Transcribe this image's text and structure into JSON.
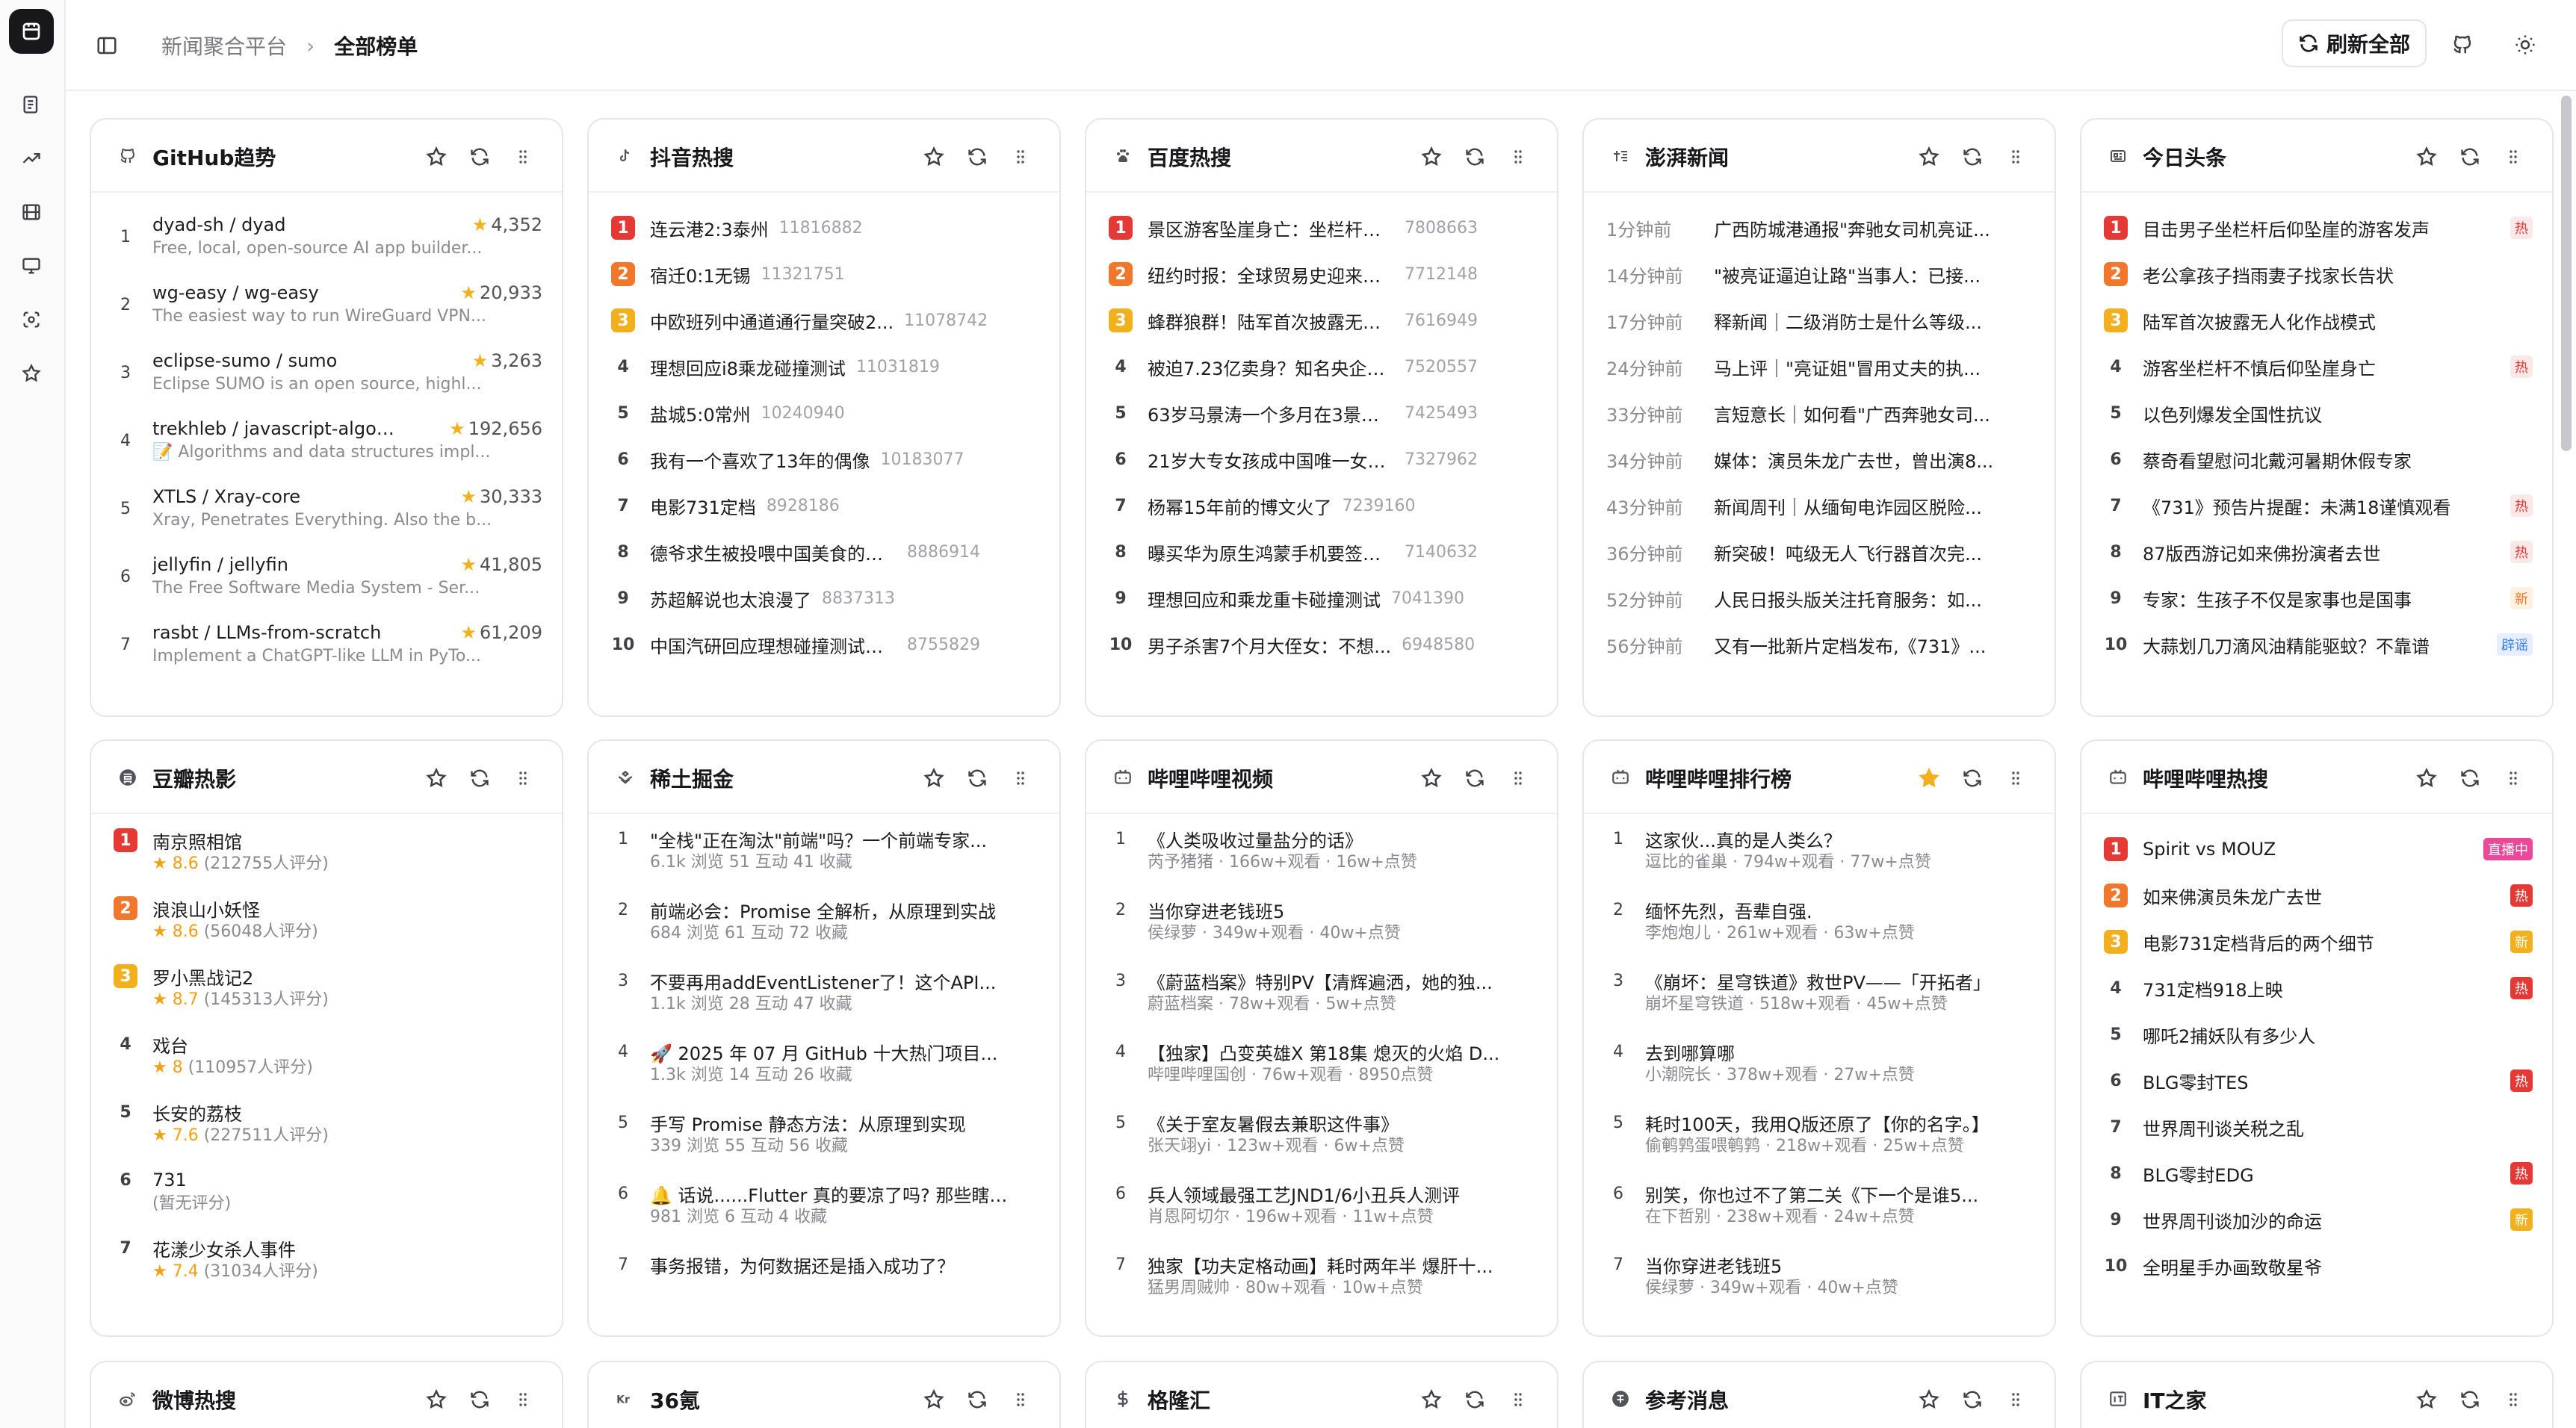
{
  "nav": {
    "breadcrumb_parent": "新闻聚合平台",
    "breadcrumb_sep": "›",
    "breadcrumb_current": "全部榜单",
    "refresh_all": "刷新全部"
  },
  "colors": {
    "rank1": "#e53935",
    "rank2": "#f0772b",
    "rank3": "#f2b01e",
    "star_active": "#f2b01e"
  },
  "cards": {
    "github": {
      "title": "GitHub趋势",
      "items": [
        {
          "rank": "1",
          "name": "dyad-sh / dyad",
          "stars": "4,352",
          "desc": "Free, local, open-source AI app builder..."
        },
        {
          "rank": "2",
          "name": "wg-easy / wg-easy",
          "stars": "20,933",
          "desc": "The easiest way to run WireGuard VPN..."
        },
        {
          "rank": "3",
          "name": "eclipse-sumo / sumo",
          "stars": "3,263",
          "desc": "Eclipse SUMO is an open source, highl..."
        },
        {
          "rank": "4",
          "name": "trekhleb / javascript-algorit...",
          "stars": "192,656",
          "desc": "📝 Algorithms and data structures impl..."
        },
        {
          "rank": "5",
          "name": "XTLS / Xray-core",
          "stars": "30,333",
          "desc": "Xray, Penetrates Everything. Also the b..."
        },
        {
          "rank": "6",
          "name": "jellyfin / jellyfin",
          "stars": "41,805",
          "desc": "The Free Software Media System - Ser..."
        },
        {
          "rank": "7",
          "name": "rasbt / LLMs-from-scratch",
          "stars": "61,209",
          "desc": "Implement a ChatGPT-like LLM in PyTo..."
        }
      ]
    },
    "douyin": {
      "title": "抖音热搜",
      "items": [
        {
          "rank": "1",
          "text": "连云港2:3泰州",
          "value": "11816882"
        },
        {
          "rank": "2",
          "text": "宿迁0:1无锡",
          "value": "11321751"
        },
        {
          "rank": "3",
          "text": "中欧班列中通道通行量突破2...",
          "value": "11078742"
        },
        {
          "rank": "4",
          "text": "理想回应i8乘龙碰撞测试",
          "value": "11031819"
        },
        {
          "rank": "5",
          "text": "盐城5:0常州",
          "value": "10240940"
        },
        {
          "rank": "6",
          "text": "我有一个喜欢了13年的偶像",
          "value": "10183077"
        },
        {
          "rank": "7",
          "text": "电影731定档",
          "value": "8928186"
        },
        {
          "rank": "8",
          "text": "德爷求生被投喂中国美食的反应",
          "value": "8886914"
        },
        {
          "rank": "9",
          "text": "苏超解说也太浪漫了",
          "value": "8837313"
        },
        {
          "rank": "10",
          "text": "中国汽研回应理想碰撞测试争议",
          "value": "8755829"
        }
      ]
    },
    "baidu": {
      "title": "百度热搜",
      "items": [
        {
          "rank": "1",
          "text": "景区游客坠崖身亡：坐栏杆上...",
          "value": "7808663"
        },
        {
          "rank": "2",
          "text": "纽约时报：全球贸易史迎来黑...",
          "value": "7712148"
        },
        {
          "rank": "3",
          "text": "蜂群狼群！陆军首次披露无人...",
          "value": "7616949"
        },
        {
          "rank": "4",
          "text": "被迫7.23亿卖身？知名央企严...",
          "value": "7520557"
        },
        {
          "rank": "5",
          "text": "63岁马景涛一个多月在3景区\"...",
          "value": "7425493"
        },
        {
          "rank": "6",
          "text": "21岁大专女孩成中国唯一女拱...",
          "value": "7327962"
        },
        {
          "rank": "7",
          "text": "杨幂15年前的博文火了",
          "value": "7239160"
        },
        {
          "rank": "8",
          "text": "曝买华为原生鸿蒙手机要签知...",
          "value": "7140632"
        },
        {
          "rank": "9",
          "text": "理想回应和乘龙重卡碰撞测试",
          "value": "7041390"
        },
        {
          "rank": "10",
          "text": "男子杀害7个月大侄女：不想...",
          "value": "6948580"
        }
      ]
    },
    "pengpai": {
      "title": "澎湃新闻",
      "items": [
        {
          "time": "1分钟前",
          "text": "广西防城港通报\"奔驰女司机亮证..."
        },
        {
          "time": "14分钟前",
          "text": "\"被亮证逼迫让路\"当事人：已接..."
        },
        {
          "time": "17分钟前",
          "text": "释新闻｜二级消防士是什么等级..."
        },
        {
          "time": "24分钟前",
          "text": "马上评｜\"亮证姐\"冒用丈夫的执..."
        },
        {
          "time": "33分钟前",
          "text": "言短意长｜如何看\"广西奔驰女司..."
        },
        {
          "time": "34分钟前",
          "text": "媒体：演员朱龙广去世，曾出演8..."
        },
        {
          "time": "43分钟前",
          "text": "新闻周刊｜从缅甸电诈园区脱险..."
        },
        {
          "time": "36分钟前",
          "text": "新突破！吨级无人飞行器首次完..."
        },
        {
          "time": "52分钟前",
          "text": "人民日报头版关注托育服务：如..."
        },
        {
          "time": "56分钟前",
          "text": "又有一批新片定档发布,《731》..."
        }
      ]
    },
    "toutiao": {
      "title": "今日头条",
      "items": [
        {
          "rank": "1",
          "text": "目击男子坐栏杆后仰坠崖的游客发声",
          "badge": "热",
          "btype": "b-hot"
        },
        {
          "rank": "2",
          "text": "老公拿孩子挡雨妻子找家长告状",
          "badge": "",
          "btype": ""
        },
        {
          "rank": "3",
          "text": "陆军首次披露无人化作战模式",
          "badge": "",
          "btype": ""
        },
        {
          "rank": "4",
          "text": "游客坐栏杆不慎后仰坠崖身亡",
          "badge": "热",
          "btype": "b-hot"
        },
        {
          "rank": "5",
          "text": "以色列爆发全国性抗议",
          "badge": "",
          "btype": ""
        },
        {
          "rank": "6",
          "text": "蔡奇看望慰问北戴河暑期休假专家",
          "badge": "",
          "btype": ""
        },
        {
          "rank": "7",
          "text": "《731》预告片提醒：未满18谨慎观看",
          "badge": "热",
          "btype": "b-hot"
        },
        {
          "rank": "8",
          "text": "87版西游记如来佛扮演者去世",
          "badge": "热",
          "btype": "b-hot"
        },
        {
          "rank": "9",
          "text": "专家：生孩子不仅是家事也是国事",
          "badge": "新",
          "btype": "b-new"
        },
        {
          "rank": "10",
          "text": "大蒜划几刀滴风油精能驱蚊？不靠谱",
          "badge": "辟谣",
          "btype": "b-rumor"
        }
      ]
    },
    "douban": {
      "title": "豆瓣热影",
      "items": [
        {
          "rank": "1",
          "text": "南京照相馆",
          "rating": "★ 8.6",
          "count": "(212755人评分)"
        },
        {
          "rank": "2",
          "text": "浪浪山小妖怪",
          "rating": "★ 8.6",
          "count": "(56048人评分)"
        },
        {
          "rank": "3",
          "text": "罗小黑战记2",
          "rating": "★ 8.7",
          "count": "(145313人评分)"
        },
        {
          "rank": "4",
          "text": "戏台",
          "rating": "★ 8",
          "count": "(110957人评分)"
        },
        {
          "rank": "5",
          "text": "长安的荔枝",
          "rating": "★ 7.6",
          "count": "(227511人评分)"
        },
        {
          "rank": "6",
          "text": "731",
          "rating": "",
          "count": "(暂无评分)"
        },
        {
          "rank": "7",
          "text": "花漾少女杀人事件",
          "rating": "★ 7.4",
          "count": "(31034人评分)"
        }
      ]
    },
    "juejin": {
      "title": "稀土掘金",
      "items": [
        {
          "rank": "1",
          "text": "\"全栈\"正在淘汰\"前端\"吗？一个前端专家...",
          "meta": "6.1k 浏览    51 互动    41 收藏"
        },
        {
          "rank": "2",
          "text": "前端必会：Promise 全解析，从原理到实战",
          "meta": "684 浏览    61 互动    72 收藏"
        },
        {
          "rank": "3",
          "text": "不要再用addEventListener了！这个API...",
          "meta": "1.1k 浏览    28 互动    47 收藏"
        },
        {
          "rank": "4",
          "text": "🚀 2025 年 07 月 GitHub 十大热门项目...",
          "meta": "1.3k 浏览    14 互动    26 收藏"
        },
        {
          "rank": "5",
          "text": "手写 Promise 静态方法：从原理到实现",
          "meta": "339 浏览    55 互动    56 收藏"
        },
        {
          "rank": "6",
          "text": "🔔 话说......Flutter 真的要凉了吗? 那些瞎吵...",
          "meta": "981 浏览    6 互动    4 收藏"
        },
        {
          "rank": "7",
          "text": "事务报错，为何数据还是插入成功了？",
          "meta": ""
        }
      ]
    },
    "bilibili_video": {
      "title": "哔哩哔哩视频",
      "items": [
        {
          "rank": "1",
          "text": "《人类吸收过量盐分的话》",
          "meta": "芮予猪猪 · 166w+观看 · 16w+点赞"
        },
        {
          "rank": "2",
          "text": "当你穿进老钱班5",
          "meta": "侯绿萝 · 349w+观看 · 40w+点赞"
        },
        {
          "rank": "3",
          "text": "《蔚蓝档案》特别PV【清辉遍洒，她的独...",
          "meta": "蔚蓝档案 · 78w+观看 · 5w+点赞"
        },
        {
          "rank": "4",
          "text": "【独家】凸变英雄X 第18集 熄灭的火焰 D...",
          "meta": "哔哩哔哩国创 · 76w+观看 · 8950点赞"
        },
        {
          "rank": "5",
          "text": "《关于室友暑假去兼职这件事》",
          "meta": "张天翊yi · 123w+观看 · 6w+点赞"
        },
        {
          "rank": "6",
          "text": "兵人领域最强工艺JND1/6小丑兵人测评",
          "meta": "肖恩阿切尔 · 196w+观看 · 11w+点赞"
        },
        {
          "rank": "7",
          "text": "独家【功夫定格动画】耗时两年半 爆肝十...",
          "meta": "猛男周贼帅 · 80w+观看 · 10w+点赞"
        }
      ]
    },
    "bilibili_rank": {
      "title": "哔哩哔哩排行榜",
      "items": [
        {
          "rank": "1",
          "text": "这家伙...真的是人类么？",
          "meta": "逗比的雀巢 · 794w+观看 · 77w+点赞"
        },
        {
          "rank": "2",
          "text": "缅怀先烈，吾辈自强.",
          "meta": "李炮炮儿 · 261w+观看 · 63w+点赞"
        },
        {
          "rank": "3",
          "text": "《崩坏：星穹铁道》救世PV——「开拓者」",
          "meta": "崩坏星穹铁道 · 518w+观看 · 45w+点赞"
        },
        {
          "rank": "4",
          "text": "去到哪算哪",
          "meta": "小潮院长 · 378w+观看 · 27w+点赞"
        },
        {
          "rank": "5",
          "text": "耗时100天，我用Q版还原了【你的名字。】",
          "meta": "偷鹌鹑蛋喂鹌鹑 · 218w+观看 · 25w+点赞"
        },
        {
          "rank": "6",
          "text": "别笑，你也过不了第二关《下一个是谁5...",
          "meta": "在下哲别 · 238w+观看 · 24w+点赞"
        },
        {
          "rank": "7",
          "text": "当你穿进老钱班5",
          "meta": "侯绿萝 · 349w+观看 · 40w+点赞"
        }
      ]
    },
    "bilibili_search": {
      "title": "哔哩哔哩热搜",
      "items": [
        {
          "rank": "1",
          "text": "Spirit vs MOUZ",
          "badge": "直播中",
          "btype": "b-live"
        },
        {
          "rank": "2",
          "text": "如来佛演员朱龙广去世",
          "badge": "热",
          "btype": "b-hotsolid"
        },
        {
          "rank": "3",
          "text": "电影731定档背后的两个细节",
          "badge": "新",
          "btype": "b-newsolid"
        },
        {
          "rank": "4",
          "text": "731定档918上映",
          "badge": "热",
          "btype": "b-hotsolid"
        },
        {
          "rank": "5",
          "text": "哪吒2捕妖队有多少人",
          "badge": "",
          "btype": ""
        },
        {
          "rank": "6",
          "text": "BLG零封TES",
          "badge": "热",
          "btype": "b-hotsolid"
        },
        {
          "rank": "7",
          "text": "世界周刊谈关税之乱",
          "badge": "",
          "btype": ""
        },
        {
          "rank": "8",
          "text": "BLG零封EDG",
          "badge": "热",
          "btype": "b-hotsolid"
        },
        {
          "rank": "9",
          "text": "世界周刊谈加沙的命运",
          "badge": "新",
          "btype": "b-newsolid"
        },
        {
          "rank": "10",
          "text": "全明星手办画致敬星爷",
          "badge": "",
          "btype": ""
        }
      ]
    },
    "weibo": {
      "title": "微博热搜"
    },
    "kr36": {
      "title": "36氪"
    },
    "gelonghui": {
      "title": "格隆汇"
    },
    "cankao": {
      "title": "参考消息"
    },
    "ithome": {
      "title": "IT之家"
    }
  }
}
